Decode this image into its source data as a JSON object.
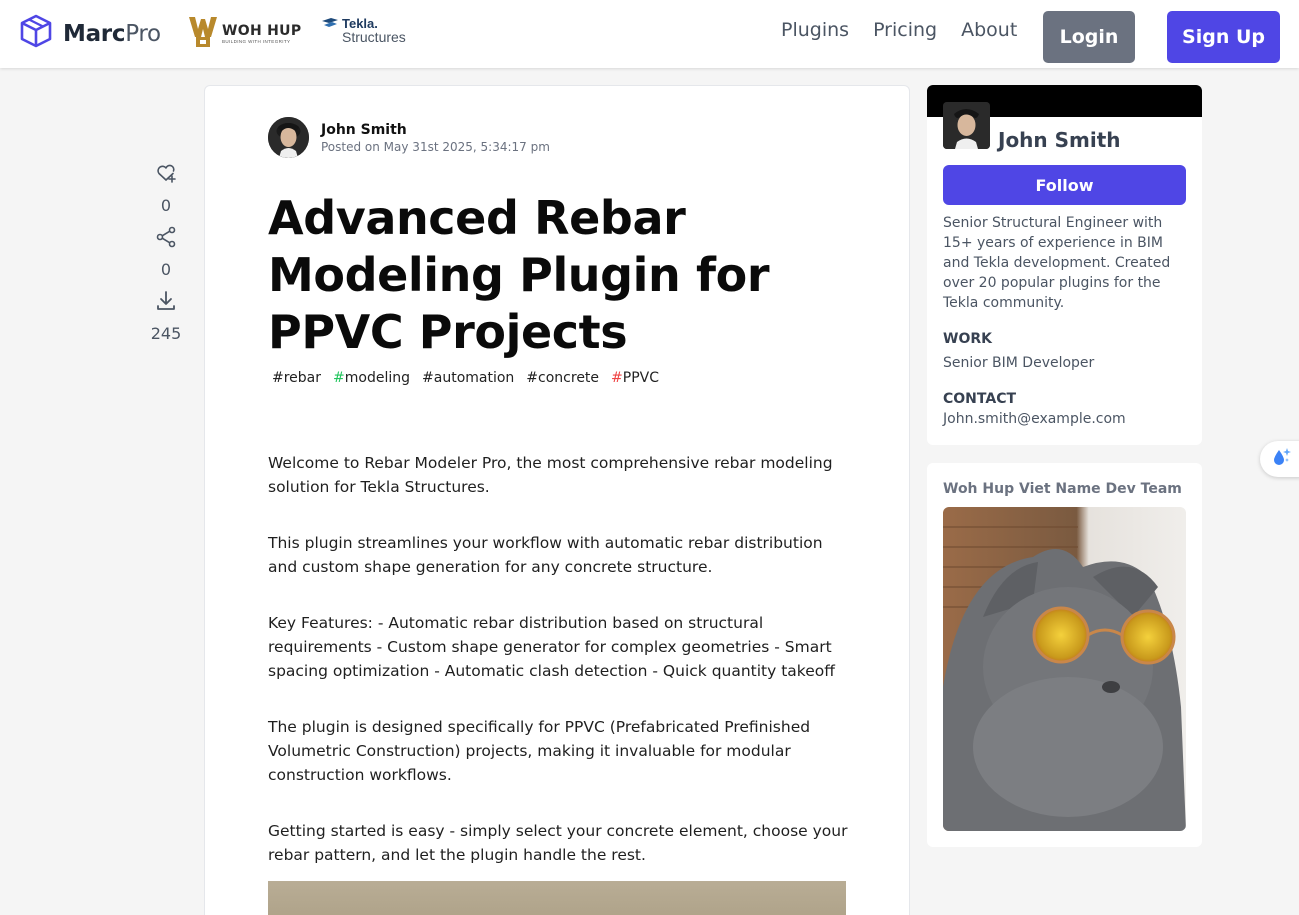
{
  "brand": {
    "name_bold": "Marc",
    "name_light": "Pro"
  },
  "partners": {
    "woh_hup": {
      "name": "WOH HUP",
      "tagline": "BUILDING WITH INTEGRITY"
    },
    "tekla": {
      "name": "Tekla.",
      "sub": "Structures"
    }
  },
  "nav": {
    "plugins": "Plugins",
    "pricing": "Pricing",
    "about": "About"
  },
  "auth": {
    "login": "Login",
    "signup": "Sign Up"
  },
  "actions": {
    "likes": "0",
    "shares": "0",
    "downloads": "245"
  },
  "post": {
    "author": "John Smith",
    "date": "Posted on May 31st 2025, 5:34:17 pm",
    "title": "Advanced Rebar Modeling Plugin for PPVC Projects",
    "tags": [
      {
        "hash": "#",
        "label": "rebar",
        "color": "#222222"
      },
      {
        "hash": "#",
        "label": "modeling",
        "color": "#22c55e"
      },
      {
        "hash": "#",
        "label": "automation",
        "color": "#222222"
      },
      {
        "hash": "#",
        "label": "concrete",
        "color": "#222222"
      },
      {
        "hash": "#",
        "label": "PPVC",
        "color": "#ef4444"
      }
    ],
    "paragraphs": [
      "Welcome to Rebar Modeler Pro, the most comprehensive rebar modeling solution for Tekla Structures.",
      "This plugin streamlines your workflow with automatic rebar distribution and custom shape generation for any concrete structure.",
      "Key Features: - Automatic rebar distribution based on structural requirements - Custom shape generator for complex geometries - Smart spacing optimization - Automatic clash detection - Quick quantity takeoff",
      "The plugin is designed specifically for PPVC (Prefabricated Prefinished Volumetric Construction) projects, making it invaluable for modular construction workflows.",
      "Getting started is easy - simply select your concrete element, choose your rebar pattern, and let the plugin handle the rest."
    ]
  },
  "profile": {
    "name": "John Smith",
    "follow": "Follow",
    "bio": "Senior Structural Engineer with 15+ years of experience in BIM and Tekla development. Created over 20 popular plugins for the Tekla community.",
    "work_label": "WORK",
    "work_value": "Senior BIM Developer",
    "contact_label": "CONTACT",
    "contact_value": "John.smith@example.com"
  },
  "team": {
    "title": "Woh Hup Viet Name Dev Team"
  },
  "colors": {
    "primary": "#4f46e5",
    "login_gray": "#6b7280",
    "page_bg": "#f5f5f5"
  }
}
